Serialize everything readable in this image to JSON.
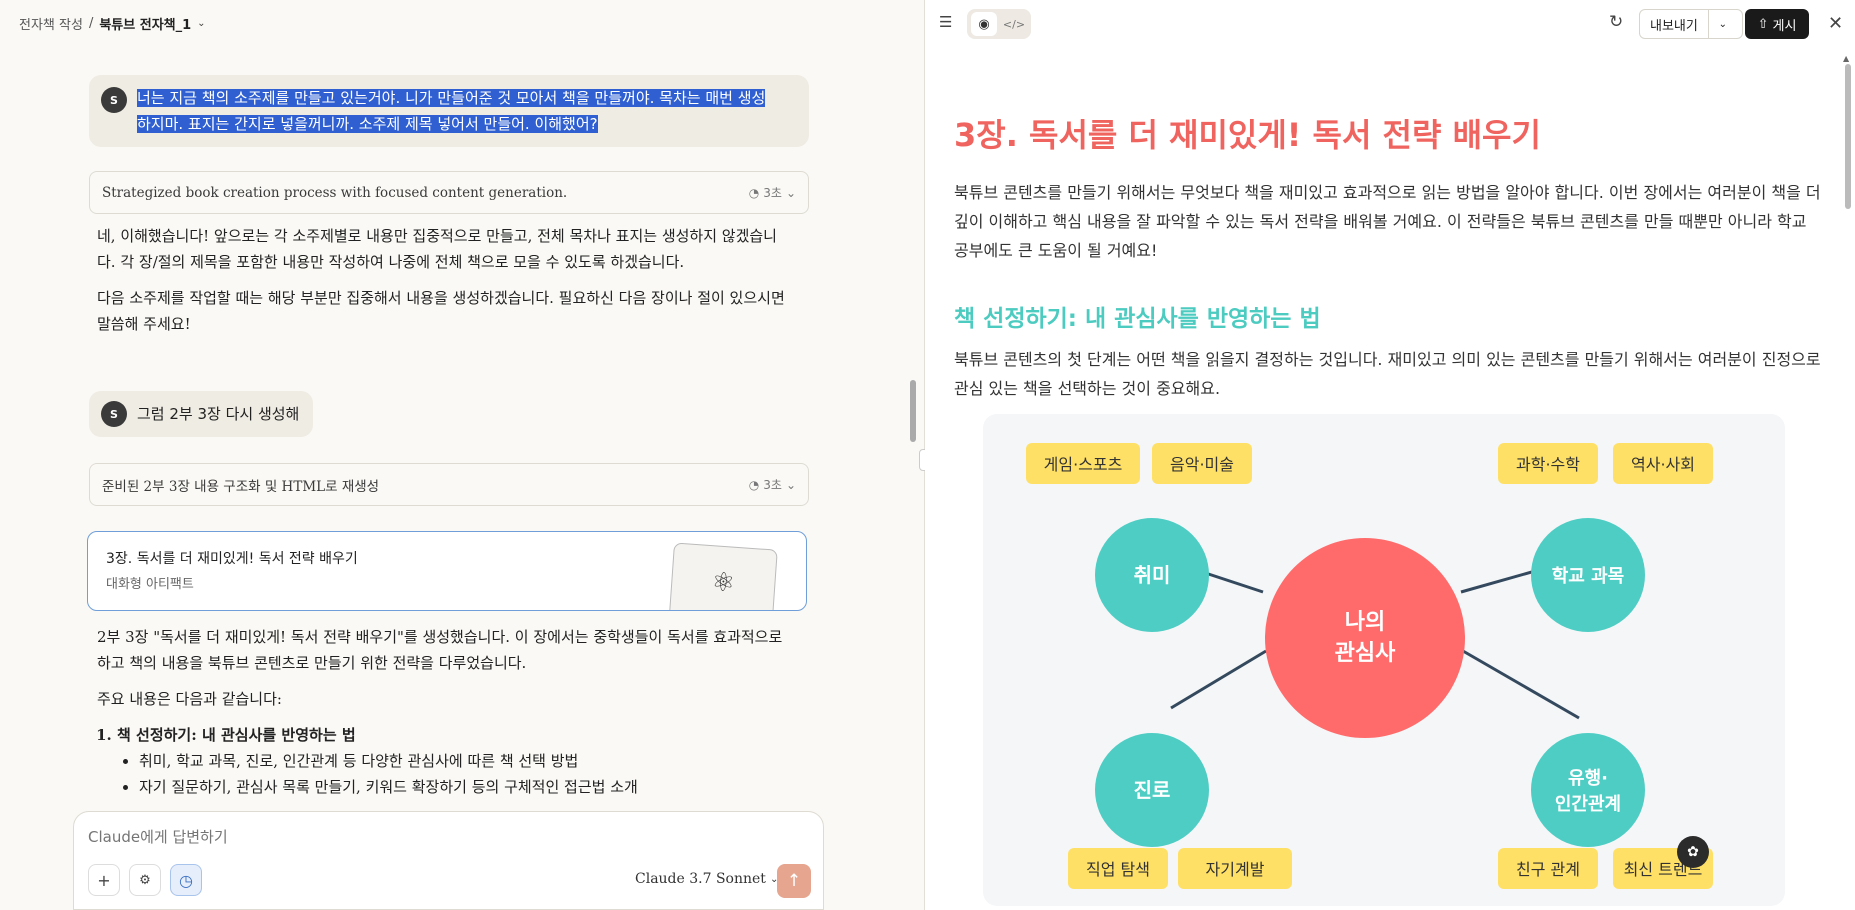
{
  "breadcrumb": {
    "parent": "전자책 작성",
    "separator": "/",
    "current": "북튜브 전자책_1"
  },
  "chat": {
    "avatar_initial": "S",
    "msg1_line1": "너는 지금 책의 소주제를 만들고 있는거야. 니가 만들어준 것 모아서 책을 만들꺼야. 목차는 매번 생성",
    "msg1_line2": "하지마. 표지는 간지로 넣을꺼니까.  소주제 제목 넣어서 만들어. 이해했어?",
    "think1_label": "Strategized book creation process with focused content generation.",
    "think1_meta": "3초",
    "reply1_p1": "네, 이해했습니다! 앞으로는 각 소주제별로 내용만 집중적으로 만들고, 전체 목차나 표지는 생성하지 않겠습니다. 각 장/절의 제목을 포함한 내용만 작성하여 나중에 전체 책으로 모을 수 있도록 하겠습니다.",
    "reply1_p2": "다음 소주제를 작업할 때는 해당 부분만 집중해서 내용을 생성하겠습니다. 필요하신 다음 장이나 절이 있으시면 말씀해 주세요!",
    "msg2": "그럼 2부 3장 다시 생성해",
    "think2_label": "준비된 2부 3장 내용 구조화 및 HTML로 재생성",
    "think2_meta": "3초",
    "artifact_title": "3장. 독서를 더 재미있게! 독서 전략 배우기",
    "artifact_sub": "대화형 아티팩트",
    "reply2_p1": "2부 3장 \"독서를 더 재미있게! 독서 전략 배우기\"를 생성했습니다. 이 장에서는 중학생들이 독서를 효과적으로 하고 책의 내용을 북튜브 콘텐츠로 만들기 위한 전략을 다루었습니다.",
    "reply2_p2": "주요 내용은 다음과 같습니다:",
    "list_item1": "책 선정하기: 내 관심사를 반영하는 법",
    "list_item1_sub1": "취미, 학교 과목, 진로, 인간관계 등 다양한 관심사에 따른 책 선택 방법",
    "list_item1_sub2": "자기 질문하기, 관심사 목록 만들기, 키워드 확장하기 등의 구체적인 접근법 소개"
  },
  "composer": {
    "placeholder": "Claude에게 답변하기",
    "model": "Claude 3.7 Sonnet"
  },
  "right_toolbar": {
    "export_label": "내보내기",
    "publish_label": "게시"
  },
  "doc": {
    "h1": "3장. 독서를 더 재미있게! 독서 전략 배우기",
    "p1": "북튜브 콘텐츠를 만들기 위해서는 무엇보다 책을 재미있고 효과적으로 읽는 방법을 알아야 합니다. 이번 장에서는 여러분이 책을 더 깊이 이해하고 핵심 내용을 잘 파악할 수 있는 독서 전략을 배워볼 거예요. 이 전략들은 북튜브 콘텐츠를 만들 때뿐만 아니라 학교 공부에도 큰 도움이 될 거예요!",
    "h2": "책 선정하기: 내 관심사를 반영하는 법",
    "p2": "북튜브 콘텐츠의 첫 단계는 어떤 책을 읽을지 결정하는 것입니다. 재미있고 의미 있는 콘텐츠를 만들기 위해서는 여러분이 진정으로 관심 있는 책을 선택하는 것이 중요해요."
  },
  "mindmap": {
    "center_line1": "나의",
    "center_line2": "관심사",
    "nodes": {
      "hobby": "취미",
      "school": "학교 과목",
      "career": "진로",
      "trend_line1": "유행·",
      "trend_line2": "인간관계"
    },
    "tags": {
      "game": "게임·스포츠",
      "music": "음악·미술",
      "science": "과학·수학",
      "history": "역사·사회",
      "job": "직업 탐색",
      "self": "자기계발",
      "friend": "친구 관계",
      "trend": "최신 트렌드"
    },
    "colors": {
      "center": "#ff6b6b",
      "node": "#4ecdc4",
      "tag": "#ffe066",
      "line": "#34495e"
    }
  }
}
